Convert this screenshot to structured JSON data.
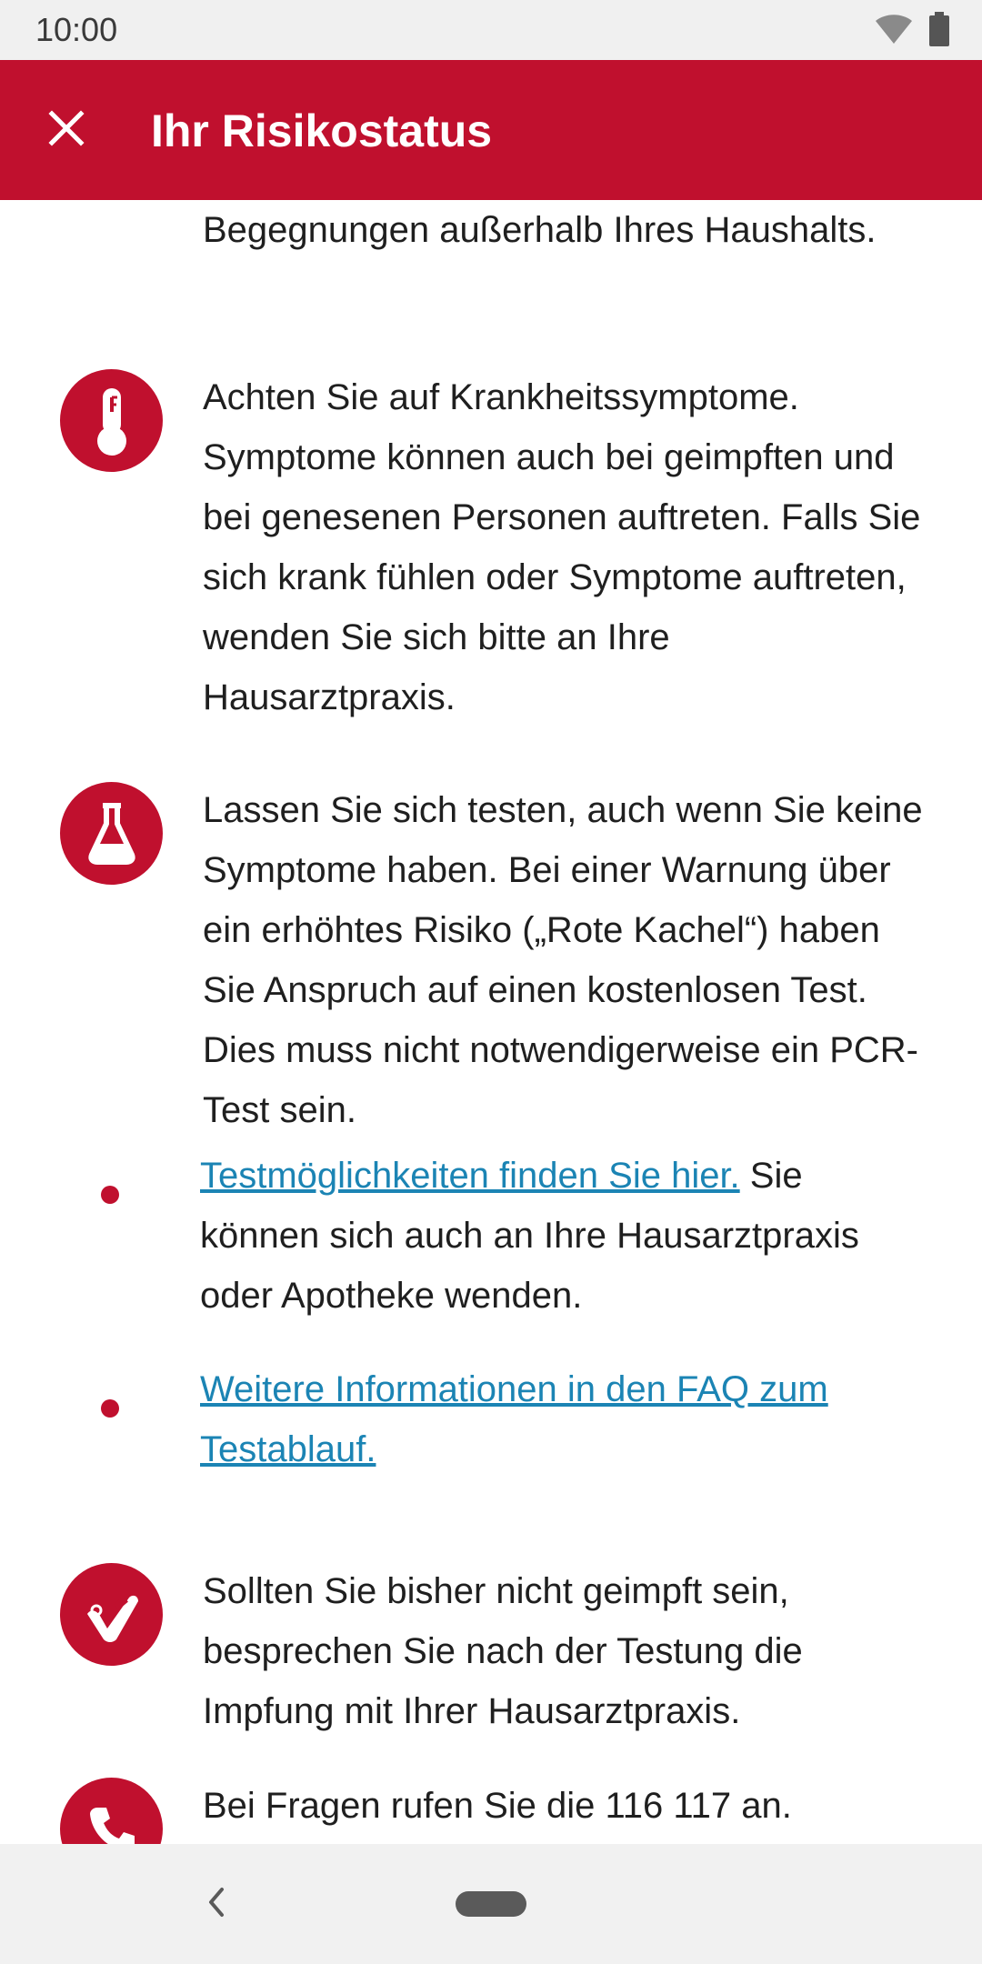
{
  "status_bar": {
    "time": "10:00",
    "icons": [
      "wifi-icon",
      "battery-icon"
    ]
  },
  "app_bar": {
    "title": "Ihr Risikostatus",
    "close_icon": "close-icon",
    "background_color": "#c0102e"
  },
  "content": {
    "intro_continuation": "Begegnungen außerhalb Ihres Haushalts.",
    "items": [
      {
        "icon": "thermometer-icon",
        "text": "Achten Sie auf Krankheitssymptome. Symptome können auch bei geimpften und bei genesenen Personen auftreten. Falls Sie sich krank fühlen oder Symptome auftreten, wenden Sie sich bitte an Ihre Hausarztpraxis."
      },
      {
        "icon": "test-tube-flask-icon",
        "text": "Lassen Sie sich testen, auch wenn Sie keine Symptome haben. Bei einer Warnung über ein erhöhtes Risiko („Rote Kachel“) haben Sie Anspruch auf einen kostenlosen Test. Dies muss nicht notwendigerweise ein PCR-Test sein."
      },
      {
        "icon": "vaccine-arm-icon",
        "text": "Sollten Sie bisher nicht geimpft sein, besprechen Sie nach der Testung die Impfung mit Ihrer Hausarztpraxis."
      },
      {
        "icon": "phone-icon",
        "text": "Bei Fragen rufen Sie die 116 117 an."
      }
    ],
    "bullets": [
      {
        "link_text": "Testmöglichkeiten finden Sie hier.",
        "rest_text": " Sie können sich auch an Ihre Hausarztpraxis oder Apotheke wenden."
      },
      {
        "link_text": "Weitere Informationen in den FAQ zum Testablauf.",
        "rest_text": ""
      }
    ]
  },
  "nav_bar": {
    "back_icon": "chevron-left-icon",
    "home_icon": "home-pill-icon"
  },
  "colors": {
    "accent": "#c0102e",
    "link": "#1b84b4",
    "text": "#1f1f1f"
  }
}
